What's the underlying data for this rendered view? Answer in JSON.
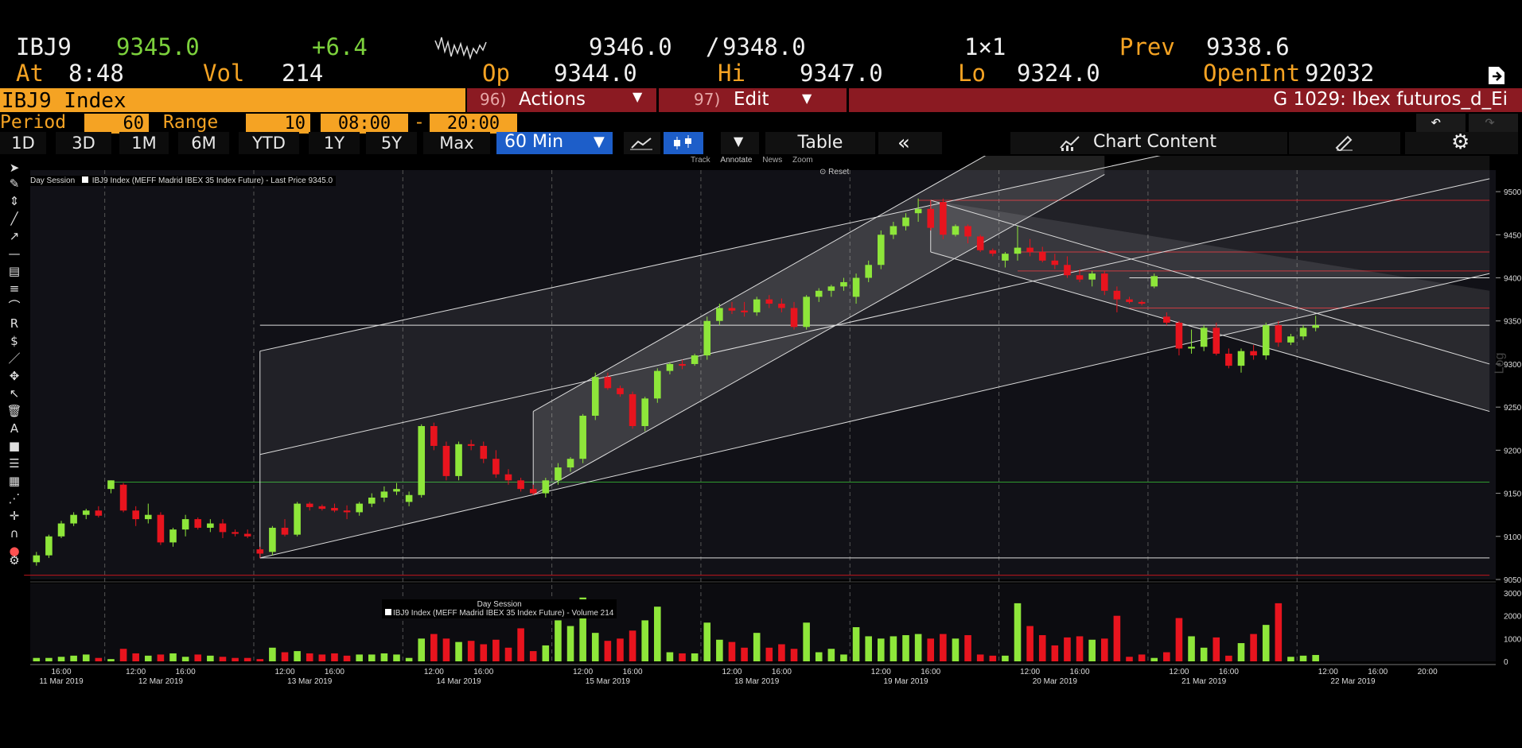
{
  "quote": {
    "ticker": "IBJ9",
    "last": "9345.0",
    "change": "+6.4",
    "bid": "9346.0",
    "slash": "/",
    "ask": "9348.0",
    "size": "1×1",
    "prev_label": "Prev",
    "prev": "9338.6",
    "at_label": "At",
    "time": "8:48",
    "vol_label": "Vol",
    "vol": "214",
    "op_label": "Op",
    "op": "9344.0",
    "hi_label": "Hi",
    "hi": "9347.0",
    "lo_label": "Lo",
    "lo": "9324.0",
    "oi_label": "OpenInt",
    "oi": "92032"
  },
  "toolbar": {
    "security": "IBJ9 Index",
    "actions_num": "96)",
    "actions": "Actions",
    "edit_num": "97)",
    "edit": "Edit",
    "chart_title": "G 1029: Ibex futuros_d_Ei"
  },
  "period": {
    "period_label": "Period",
    "period_value": "60",
    "range_label": "Range",
    "range_value": "10",
    "start": "08:00",
    "dash": "-",
    "end": "20:00"
  },
  "ranges": [
    "1D",
    "3D",
    "1M",
    "6M",
    "YTD",
    "1Y",
    "5Y",
    "Max"
  ],
  "interval": "60 Min",
  "table_label": "Table",
  "chart_content_label": "Chart Content",
  "annotate_bar": {
    "track": "Track",
    "annotate": "Annotate",
    "news": "News",
    "zoom": "Zoom",
    "reset": "Reset"
  },
  "legend": {
    "session": "Day Session",
    "series": "IBJ9 Index (MEFF Madrid IBEX 35 Index Future) - Last Price 9345.0",
    "vol_session": "Day Session",
    "vol_series": "IBJ9 Index (MEFF Madrid IBEX 35 Index Future) - Volume 214"
  },
  "side_label": "Log",
  "colors": {
    "up": "#8ee63a",
    "down": "#e8141e",
    "orange": "#f5a323",
    "green_text": "#7cd13c",
    "header_red": "#8b1a22",
    "active_blue": "#1d5ec9"
  },
  "chart_data": {
    "type": "candlestick",
    "ylim": [
      9050,
      9525
    ],
    "yticks": [
      9050,
      9100,
      9150,
      9200,
      9250,
      9300,
      9350,
      9400,
      9450,
      9500
    ],
    "vol_ylim": [
      0,
      3000
    ],
    "vol_yticks": [
      0,
      1000,
      2000,
      3000
    ],
    "hour_ticks": [
      {
        "i": 2,
        "label": "16:00"
      },
      {
        "i": 8,
        "label": "12:00"
      },
      {
        "i": 12,
        "label": "16:00"
      },
      {
        "i": 20,
        "label": "12:00"
      },
      {
        "i": 24,
        "label": "16:00"
      },
      {
        "i": 32,
        "label": "12:00"
      },
      {
        "i": 36,
        "label": "16:00"
      },
      {
        "i": 44,
        "label": "12:00"
      },
      {
        "i": 48,
        "label": "16:00"
      },
      {
        "i": 56,
        "label": "12:00"
      },
      {
        "i": 60,
        "label": "16:00"
      },
      {
        "i": 68,
        "label": "12:00"
      },
      {
        "i": 72,
        "label": "16:00"
      },
      {
        "i": 80,
        "label": "12:00"
      },
      {
        "i": 84,
        "label": "16:00"
      },
      {
        "i": 92,
        "label": "12:00"
      },
      {
        "i": 96,
        "label": "16:00"
      },
      {
        "i": 104,
        "label": "12:00"
      },
      {
        "i": 108,
        "label": "16:00"
      },
      {
        "i": 112,
        "label": "20:00"
      }
    ],
    "date_labels": [
      {
        "i": 2,
        "label": "11 Mar 2019"
      },
      {
        "i": 10,
        "label": "12 Mar 2019"
      },
      {
        "i": 22,
        "label": "13 Mar 2019"
      },
      {
        "i": 34,
        "label": "14 Mar 2019"
      },
      {
        "i": 46,
        "label": "15 Mar 2019"
      },
      {
        "i": 58,
        "label": "18 Mar 2019"
      },
      {
        "i": 70,
        "label": "19 Mar 2019"
      },
      {
        "i": 82,
        "label": "20 Mar 2019"
      },
      {
        "i": 94,
        "label": "21 Mar 2019"
      },
      {
        "i": 106,
        "label": "22 Mar 2019"
      }
    ],
    "day_separators": [
      6,
      18,
      30,
      42,
      54,
      66,
      78,
      90,
      102
    ],
    "candles": [
      [
        9070,
        9082,
        9066,
        9078,
        150
      ],
      [
        9078,
        9102,
        9075,
        9100,
        150
      ],
      [
        9100,
        9118,
        9098,
        9115,
        200
      ],
      [
        9115,
        9128,
        9112,
        9125,
        250
      ],
      [
        9125,
        9132,
        9120,
        9130,
        300
      ],
      [
        9130,
        9135,
        9122,
        9124,
        150
      ],
      [
        9155,
        9165,
        9150,
        9165,
        100
      ],
      [
        9160,
        9162,
        9128,
        9130,
        550
      ],
      [
        9130,
        9135,
        9112,
        9120,
        350
      ],
      [
        9120,
        9138,
        9115,
        9125,
        250
      ],
      [
        9125,
        9128,
        9090,
        9093,
        300
      ],
      [
        9093,
        9110,
        9088,
        9108,
        350
      ],
      [
        9108,
        9125,
        9100,
        9120,
        200
      ],
      [
        9120,
        9122,
        9108,
        9110,
        300
      ],
      [
        9110,
        9120,
        9105,
        9115,
        250
      ],
      [
        9115,
        9120,
        9098,
        9105,
        200
      ],
      [
        9105,
        9108,
        9100,
        9103,
        150
      ],
      [
        9103,
        9108,
        9098,
        9100,
        150
      ],
      [
        9085,
        9088,
        9075,
        9080,
        100
      ],
      [
        9082,
        9112,
        9078,
        9110,
        600
      ],
      [
        9110,
        9120,
        9100,
        9102,
        400
      ],
      [
        9102,
        9140,
        9100,
        9138,
        450
      ],
      [
        9138,
        9140,
        9130,
        9134,
        350
      ],
      [
        9135,
        9137,
        9130,
        9132,
        300
      ],
      [
        9133,
        9138,
        9128,
        9130,
        350
      ],
      [
        9130,
        9136,
        9120,
        9128,
        250
      ],
      [
        9128,
        9140,
        9124,
        9138,
        300
      ],
      [
        9138,
        9150,
        9134,
        9145,
        300
      ],
      [
        9145,
        9158,
        9140,
        9152,
        350
      ],
      [
        9152,
        9162,
        9148,
        9155,
        300
      ],
      [
        9140,
        9152,
        9135,
        9148,
        150
      ],
      [
        9148,
        9230,
        9145,
        9228,
        1000
      ],
      [
        9228,
        9232,
        9200,
        9205,
        1200
      ],
      [
        9205,
        9210,
        9165,
        9170,
        1000
      ],
      [
        9170,
        9210,
        9165,
        9207,
        850
      ],
      [
        9207,
        9212,
        9200,
        9205,
        900
      ],
      [
        9205,
        9210,
        9185,
        9190,
        750
      ],
      [
        9190,
        9200,
        9168,
        9172,
        950
      ],
      [
        9172,
        9178,
        9160,
        9165,
        600
      ],
      [
        9165,
        9168,
        9152,
        9155,
        1450
      ],
      [
        9155,
        9160,
        9148,
        9150,
        450
      ],
      [
        9150,
        9168,
        9145,
        9165,
        700
      ],
      [
        9165,
        9185,
        9160,
        9180,
        1800
      ],
      [
        9180,
        9192,
        9175,
        9190,
        1550
      ],
      [
        9190,
        9242,
        9185,
        9240,
        2800
      ],
      [
        9240,
        9290,
        9235,
        9285,
        1250
      ],
      [
        9285,
        9290,
        9270,
        9272,
        900
      ],
      [
        9272,
        9275,
        9262,
        9265,
        1000
      ],
      [
        9265,
        9268,
        9225,
        9228,
        1350
      ],
      [
        9228,
        9262,
        9222,
        9260,
        1800
      ],
      [
        9260,
        9295,
        9255,
        9292,
        2400
      ],
      [
        9292,
        9302,
        9288,
        9300,
        400
      ],
      [
        9300,
        9305,
        9294,
        9298,
        350
      ],
      [
        9300,
        9312,
        9298,
        9310,
        350
      ],
      [
        9310,
        9355,
        9305,
        9350,
        1700
      ],
      [
        9350,
        9370,
        9345,
        9365,
        950
      ],
      [
        9365,
        9372,
        9358,
        9362,
        850
      ],
      [
        9362,
        9372,
        9355,
        9360,
        600
      ],
      [
        9360,
        9378,
        9356,
        9375,
        1250
      ],
      [
        9375,
        9380,
        9365,
        9370,
        600
      ],
      [
        9370,
        9376,
        9360,
        9365,
        750
      ],
      [
        9365,
        9372,
        9340,
        9343,
        550
      ],
      [
        9343,
        9380,
        9340,
        9378,
        1700
      ],
      [
        9378,
        9388,
        9372,
        9385,
        400
      ],
      [
        9385,
        9392,
        9378,
        9390,
        550
      ],
      [
        9390,
        9400,
        9385,
        9395,
        300
      ],
      [
        9378,
        9405,
        9370,
        9400,
        1500
      ],
      [
        9400,
        9420,
        9395,
        9415,
        1100
      ],
      [
        9415,
        9455,
        9410,
        9450,
        1000
      ],
      [
        9450,
        9465,
        9445,
        9460,
        1100
      ],
      [
        9460,
        9475,
        9455,
        9470,
        1150
      ],
      [
        9475,
        9492,
        9465,
        9480,
        1200
      ],
      [
        9480,
        9490,
        9455,
        9458,
        1000
      ],
      [
        9488,
        9492,
        9445,
        9450,
        1200
      ],
      [
        9450,
        9462,
        9448,
        9460,
        1000
      ],
      [
        9460,
        9462,
        9440,
        9448,
        1150
      ],
      [
        9448,
        9450,
        9430,
        9432,
        300
      ],
      [
        9432,
        9434,
        9425,
        9428,
        250
      ],
      [
        9420,
        9430,
        9412,
        9428,
        250
      ],
      [
        9428,
        9460,
        9420,
        9435,
        2550
      ],
      [
        9435,
        9445,
        9425,
        9430,
        1550
      ],
      [
        9430,
        9436,
        9418,
        9420,
        1150
      ],
      [
        9420,
        9428,
        9410,
        9415,
        700
      ],
      [
        9415,
        9425,
        9400,
        9403,
        1050
      ],
      [
        9403,
        9410,
        9395,
        9398,
        1100
      ],
      [
        9398,
        9408,
        9390,
        9405,
        950
      ],
      [
        9405,
        9408,
        9380,
        9385,
        1000
      ],
      [
        9385,
        9390,
        9360,
        9375,
        2000
      ],
      [
        9375,
        9378,
        9370,
        9372,
        200
      ],
      [
        9372,
        9374,
        9368,
        9370,
        300
      ],
      [
        9390,
        9405,
        9388,
        9402,
        150
      ],
      [
        9355,
        9360,
        9345,
        9348,
        400
      ],
      [
        9348,
        9350,
        9310,
        9318,
        1900
      ],
      [
        9318,
        9340,
        9312,
        9320,
        1100
      ],
      [
        9320,
        9345,
        9315,
        9342,
        600
      ],
      [
        9342,
        9348,
        9310,
        9312,
        1050
      ],
      [
        9312,
        9318,
        9295,
        9298,
        250
      ],
      [
        9298,
        9318,
        9290,
        9315,
        800
      ],
      [
        9315,
        9322,
        9305,
        9310,
        1200
      ],
      [
        9310,
        9348,
        9305,
        9345,
        1600
      ],
      [
        9345,
        9350,
        9320,
        9325,
        2550
      ],
      [
        9325,
        9335,
        9322,
        9332,
        200
      ],
      [
        9332,
        9345,
        9328,
        9342,
        250
      ],
      [
        9342,
        9356,
        9338,
        9345,
        280
      ]
    ]
  }
}
